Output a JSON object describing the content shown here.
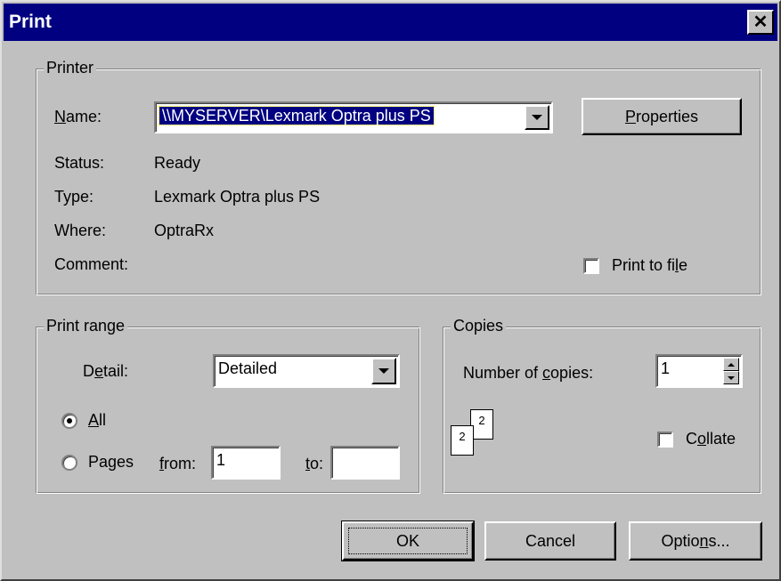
{
  "window": {
    "title": "Print"
  },
  "printer": {
    "group_label": "Printer",
    "name_label_prefix": "",
    "name_label_accel": "N",
    "name_label_rest": "ame:",
    "name_value": "\\\\MYSERVER\\Lexmark Optra plus PS",
    "properties_accel": "P",
    "properties_rest": "roperties",
    "status_label": "Status:",
    "status_value": "Ready",
    "type_label": "Type:",
    "type_value": "Lexmark Optra plus PS",
    "where_label": "Where:",
    "where_value": "OptraRx",
    "comment_label": "Comment:",
    "print_to_file_pre": "Print to fi",
    "print_to_file_accel": "l",
    "print_to_file_post": "e",
    "print_to_file_checked": false
  },
  "print_range": {
    "group_label": "Print range",
    "detail_pre": "D",
    "detail_accel": "e",
    "detail_post": "tail:",
    "detail_value": "Detailed",
    "all_accel": "A",
    "all_rest": "ll",
    "all_selected": true,
    "pages_label": "Pages",
    "from_accel": "f",
    "from_rest": "rom:",
    "from_value": "1",
    "to_accel": "t",
    "to_rest": "o:",
    "to_value": ""
  },
  "copies": {
    "group_label": "Copies",
    "num_pre": "Number of ",
    "num_accel": "c",
    "num_post": "opies:",
    "num_value": "1",
    "collate_pre": "C",
    "collate_accel": "o",
    "collate_post": "llate",
    "collate_checked": false,
    "page_icon_front": "2",
    "page_icon_back": "2"
  },
  "buttons": {
    "ok": "OK",
    "cancel": "Cancel",
    "options_pre": "Optio",
    "options_accel": "n",
    "options_post": "s..."
  },
  "colors": {
    "titlebar": "#000080",
    "face": "#c0c0c0",
    "selection": "#000080"
  }
}
